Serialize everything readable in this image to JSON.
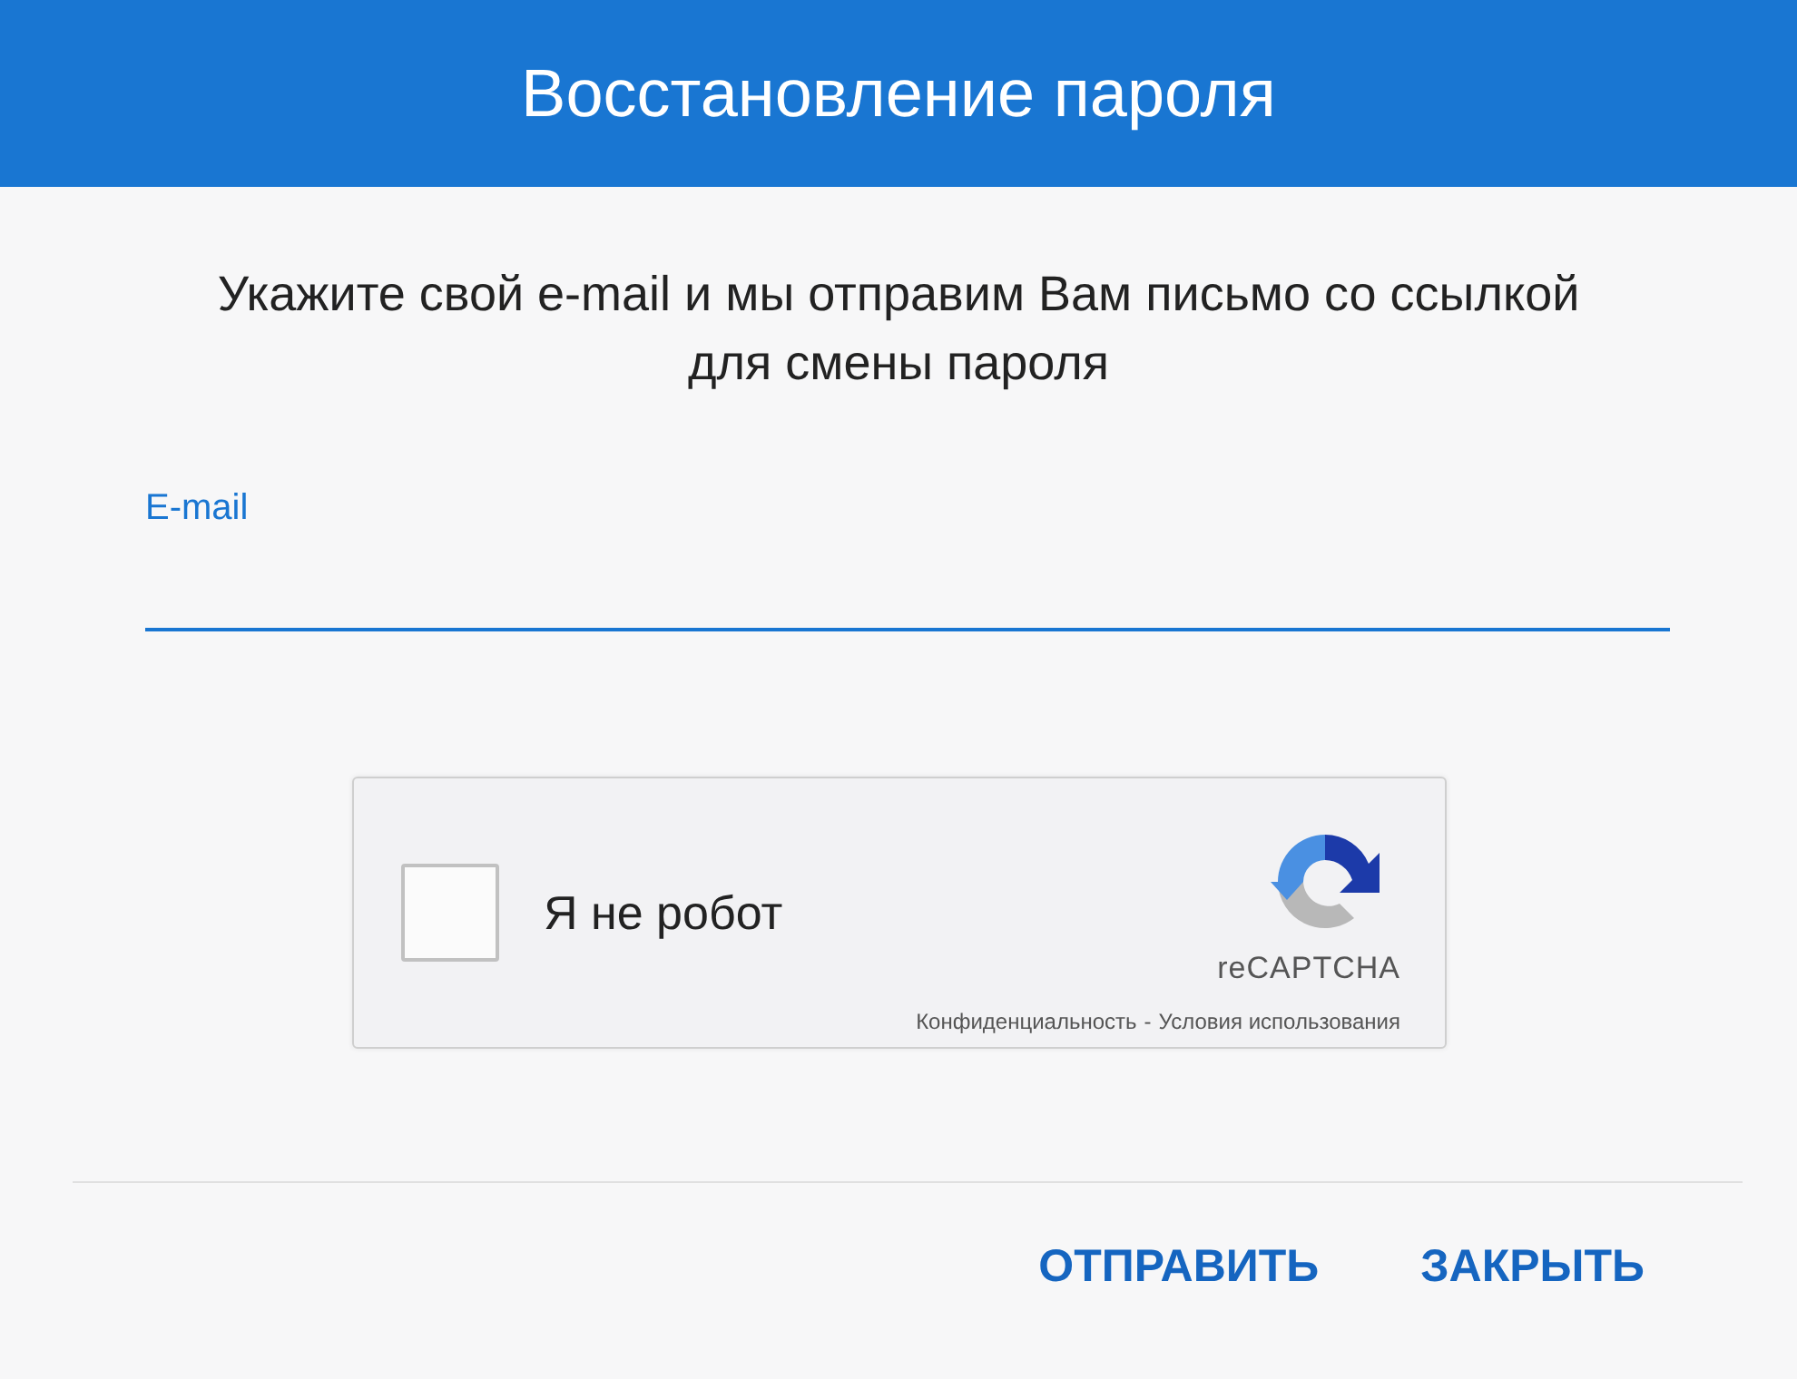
{
  "dialog": {
    "title": "Восстановление пароля",
    "message": "Укажите свой e-mail и мы отправим Вам письмо со ссылкой для смены пароля"
  },
  "email_field": {
    "label": "E-mail"
  },
  "captcha": {
    "checked": false,
    "label": "Я не робот",
    "brand": "reCAPTCHA",
    "privacy_link": "Конфиденциальность",
    "separator": "-",
    "terms_link": "Условия использования"
  },
  "buttons": [
    "ОТПРАВИТЬ",
    "ЗАКРЫТЬ"
  ]
}
